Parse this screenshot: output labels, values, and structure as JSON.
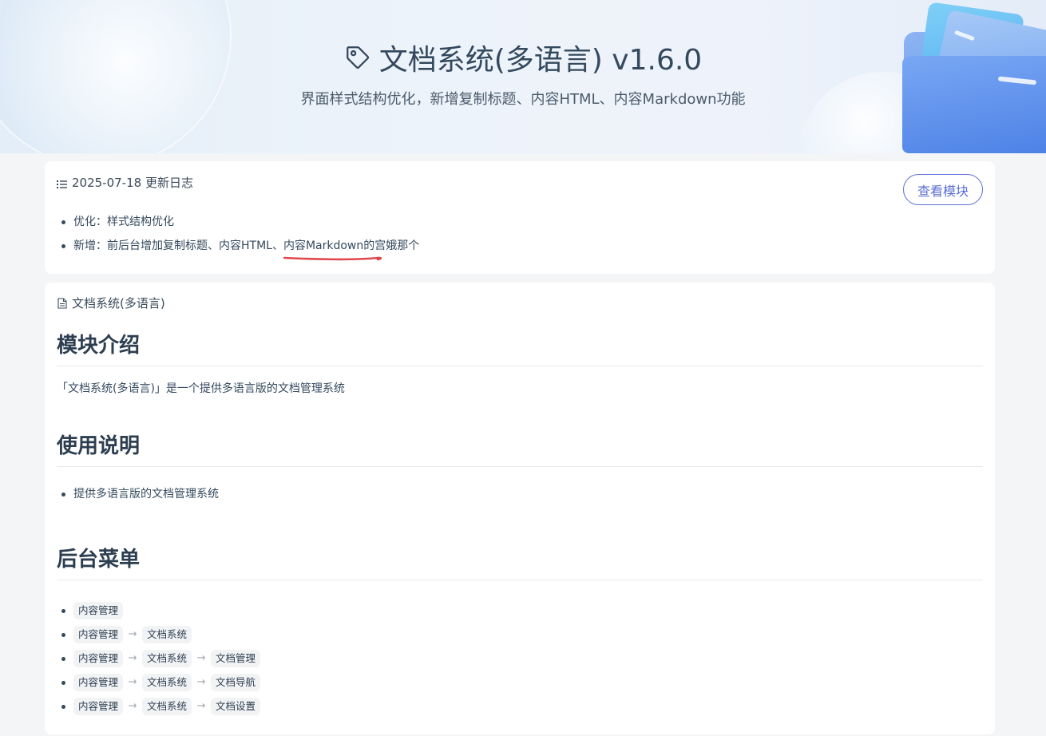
{
  "banner": {
    "title": "文档系统(多语言) v1.6.0",
    "subtitle": "界面样式结构优化，新增复制标题、内容HTML、内容Markdown功能",
    "icon": "tag-icon"
  },
  "changelog": {
    "date_title": "2025-07-18 更新日志",
    "view_button": "查看模块",
    "items": [
      "优化：样式结构优化",
      "新增：前后台增加复制标题、内容HTML、内容Markdown的宫娥那个"
    ],
    "highlight_color": "#e0474c"
  },
  "doc": {
    "module_name": "文档系统(多语言)",
    "sections": {
      "intro_title": "模块介绍",
      "intro_text": "「文档系统(多语言)」是一个提供多语言版的文档管理系统",
      "usage_title": "使用说明",
      "usage_items": [
        "提供多语言版的文档管理系统"
      ],
      "menu_title": "后台菜单"
    },
    "menu_paths": [
      [
        "内容管理"
      ],
      [
        "内容管理",
        "文档系统"
      ],
      [
        "内容管理",
        "文档系统",
        "文档管理"
      ],
      [
        "内容管理",
        "文档系统",
        "文档导航"
      ],
      [
        "内容管理",
        "文档系统",
        "文档设置"
      ]
    ],
    "arrow": "→"
  },
  "colors": {
    "accent": "#5b6fd6",
    "text": "#2c3e50",
    "background": "#f3f5f7"
  }
}
